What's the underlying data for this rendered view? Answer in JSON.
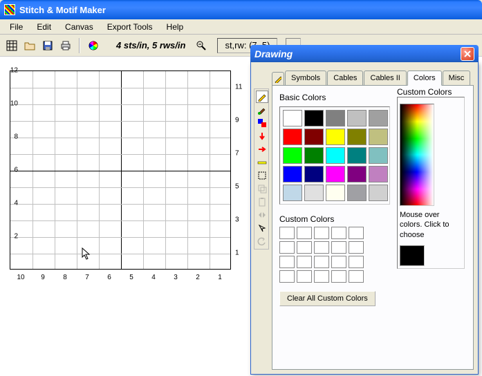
{
  "title": "Stitch & Motif Maker",
  "menu": [
    "File",
    "Edit",
    "Canvas",
    "Export Tools",
    "Help"
  ],
  "toolbar": {
    "density": "4 sts/in, 5 rws/in",
    "coord": "st,rw: (7, 5)"
  },
  "grid": {
    "cols": 10,
    "rows": 12,
    "ylabels": [
      "12",
      "10",
      "8",
      "6",
      "4",
      "2"
    ],
    "rlabels_nums": [
      "11",
      "9",
      "7",
      "5",
      "3",
      "1"
    ],
    "xlabels": [
      "10",
      "9",
      "8",
      "7",
      "6",
      "5",
      "4",
      "3",
      "2",
      "1"
    ]
  },
  "drawing": {
    "title": "Drawing",
    "tabs": [
      "Symbols",
      "Cables",
      "Cables II",
      "Colors",
      "Misc"
    ],
    "active_tab": "Colors",
    "basic_label": "Basic Colors",
    "custom_label": "Custom Colors",
    "custom_section_label": "Custom Colors",
    "hint": "Mouse over colors. Click to choose",
    "clear_btn": "Clear All Custom Colors",
    "basic_colors": [
      "#ffffff",
      "#000000",
      "#808080",
      "#c0c0c0",
      "#a0a0a0",
      "#ff0000",
      "#800000",
      "#ffff00",
      "#808000",
      "#c0c080",
      "#00ff00",
      "#008000",
      "#00ffff",
      "#008080",
      "#80c0c0",
      "#0000ff",
      "#000080",
      "#ff00ff",
      "#800080",
      "#c080c0",
      "#c0d8e8",
      "#e0e0e0",
      "#fffff0",
      "#a0a0a4",
      "#d0d0d0"
    ]
  }
}
